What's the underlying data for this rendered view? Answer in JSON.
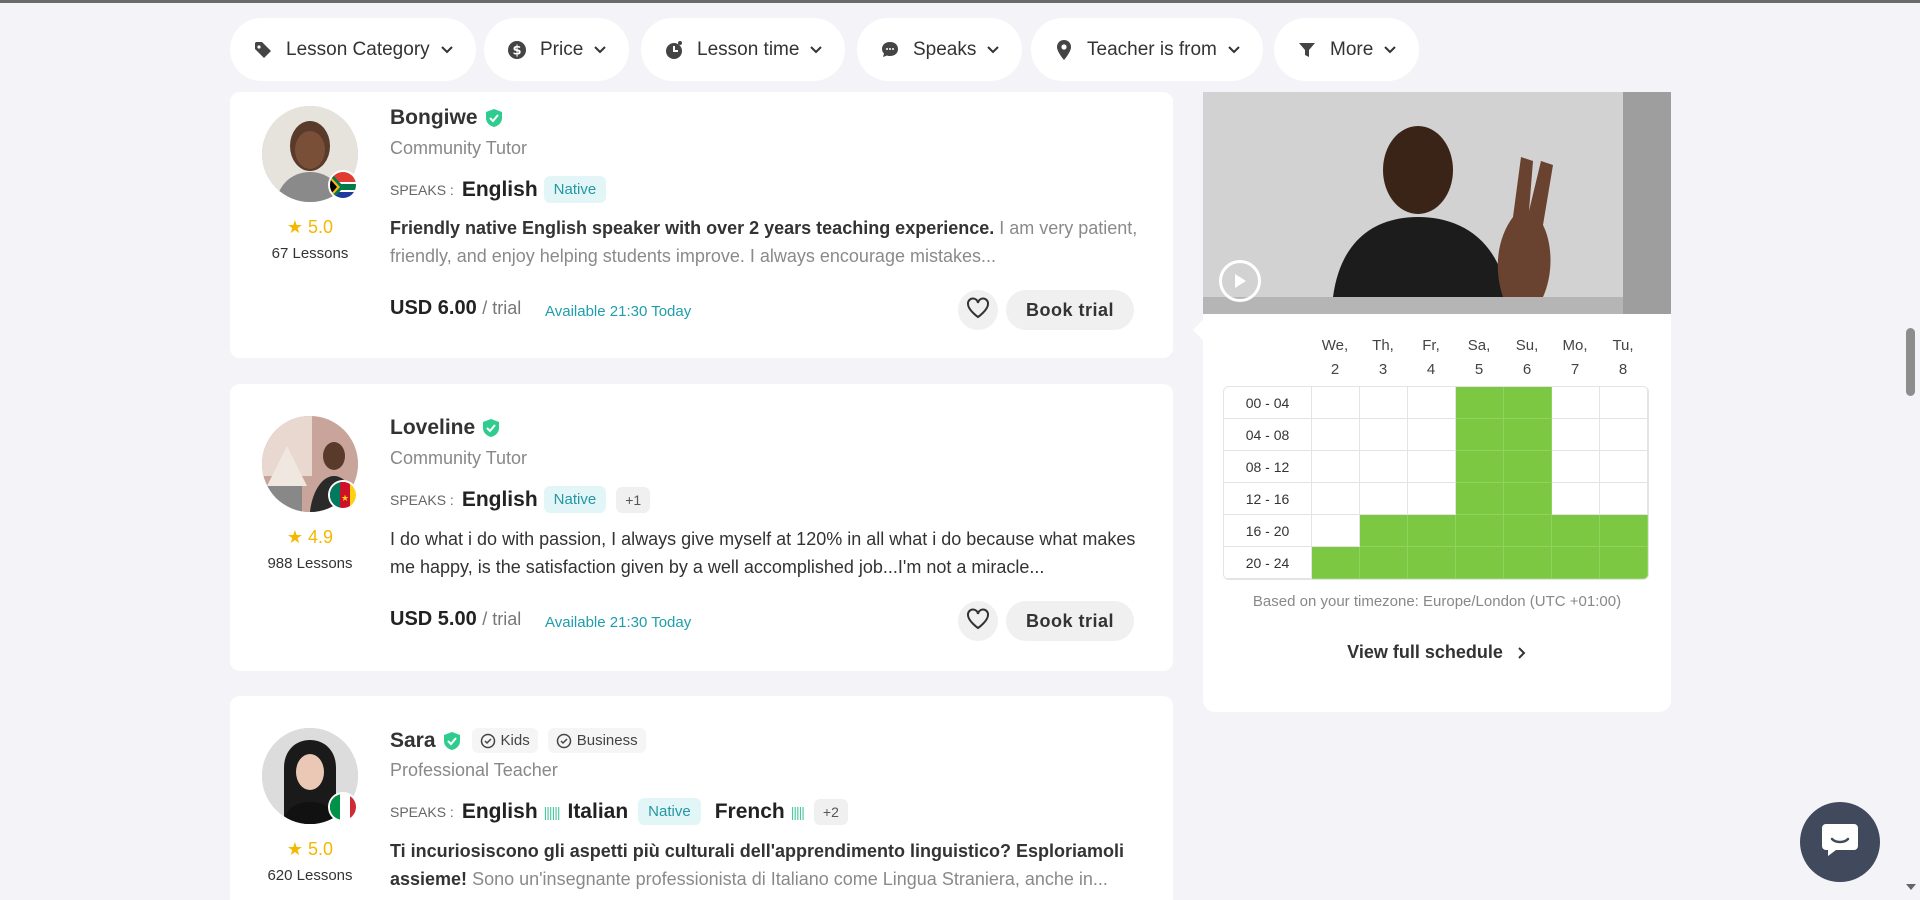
{
  "filters": [
    {
      "label": "Lesson Category",
      "icon": "tag-icon"
    },
    {
      "label": "Price",
      "icon": "dollar-icon"
    },
    {
      "label": "Lesson time",
      "icon": "clock-icon"
    },
    {
      "label": "Speaks",
      "icon": "chat-bubble-icon"
    },
    {
      "label": "Teacher is from",
      "icon": "location-pin-icon"
    },
    {
      "label": "More",
      "icon": "filter-funnel-icon"
    }
  ],
  "teachers": [
    {
      "name": "Bongiwe",
      "title": "Community Tutor",
      "speaks_label": "SPEAKS :",
      "language": "English",
      "native_label": "Native",
      "rating": "5.0",
      "lessons": "67 Lessons",
      "desc_bold": "Friendly native English speaker with over 2 years teaching experience.",
      "desc_rest": " I am very patient, friendly, and enjoy helping students improve. I always encourage mistakes...",
      "price": "USD 6.00",
      "per": "/ trial",
      "available": "Available 21:30 Today",
      "book": "Book trial",
      "flag": "south-africa"
    },
    {
      "name": "Loveline",
      "title": "Community Tutor",
      "speaks_label": "SPEAKS :",
      "language": "English",
      "native_label": "Native",
      "extra_langs": "+1",
      "rating": "4.9",
      "lessons": "988 Lessons",
      "desc_plain": "I do what i do with passion, I always give myself at 120% in all what i do because what makes me happy, is the satisfaction given by a well accomplished job...I'm not a miracle...",
      "price": "USD 5.00",
      "per": "/ trial",
      "available": "Available 21:30 Today",
      "book": "Book trial",
      "flag": "cameroon"
    },
    {
      "name": "Sara",
      "badges": [
        "Kids",
        "Business"
      ],
      "title": "Professional Teacher",
      "speaks_label": "SPEAKS :",
      "languages": [
        "English",
        "Italian",
        "French"
      ],
      "native_label": "Native",
      "extra_langs": "+2",
      "rating": "5.0",
      "lessons": "620 Lessons",
      "desc_bold": "Ti incuriosiscono gli aspetti più culturali dell'apprendimento linguistico? Esploriamoli assieme!",
      "desc_rest": " Sono un'insegnante professionista di Italiano come Lingua Straniera, anche in...",
      "flag": "italy"
    }
  ],
  "schedule": {
    "days": [
      [
        "We,",
        "2"
      ],
      [
        "Th,",
        "3"
      ],
      [
        "Fr,",
        "4"
      ],
      [
        "Sa,",
        "5"
      ],
      [
        "Su,",
        "6"
      ],
      [
        "Mo,",
        "7"
      ],
      [
        "Tu,",
        "8"
      ]
    ],
    "slots": [
      "00 - 04",
      "04 - 08",
      "08 - 12",
      "12 - 16",
      "16 - 20",
      "20 - 24"
    ],
    "availability": [
      [
        0,
        0,
        0,
        1,
        1,
        0,
        0
      ],
      [
        0,
        0,
        0,
        1,
        1,
        0,
        0
      ],
      [
        0,
        0,
        0,
        1,
        1,
        0,
        0
      ],
      [
        0,
        0,
        0,
        1,
        1,
        0,
        0
      ],
      [
        0,
        1,
        1,
        1,
        1,
        1,
        1
      ],
      [
        1,
        1,
        1,
        1,
        1,
        1,
        1
      ]
    ],
    "timezone_note": "Based on your timezone: Europe/London (UTC +01:00)",
    "view_full": "View full schedule"
  },
  "colors": {
    "available": "#7cc843",
    "accent": "#1f9eaa",
    "star": "#f5b800",
    "verified": "#2ecc8f"
  }
}
